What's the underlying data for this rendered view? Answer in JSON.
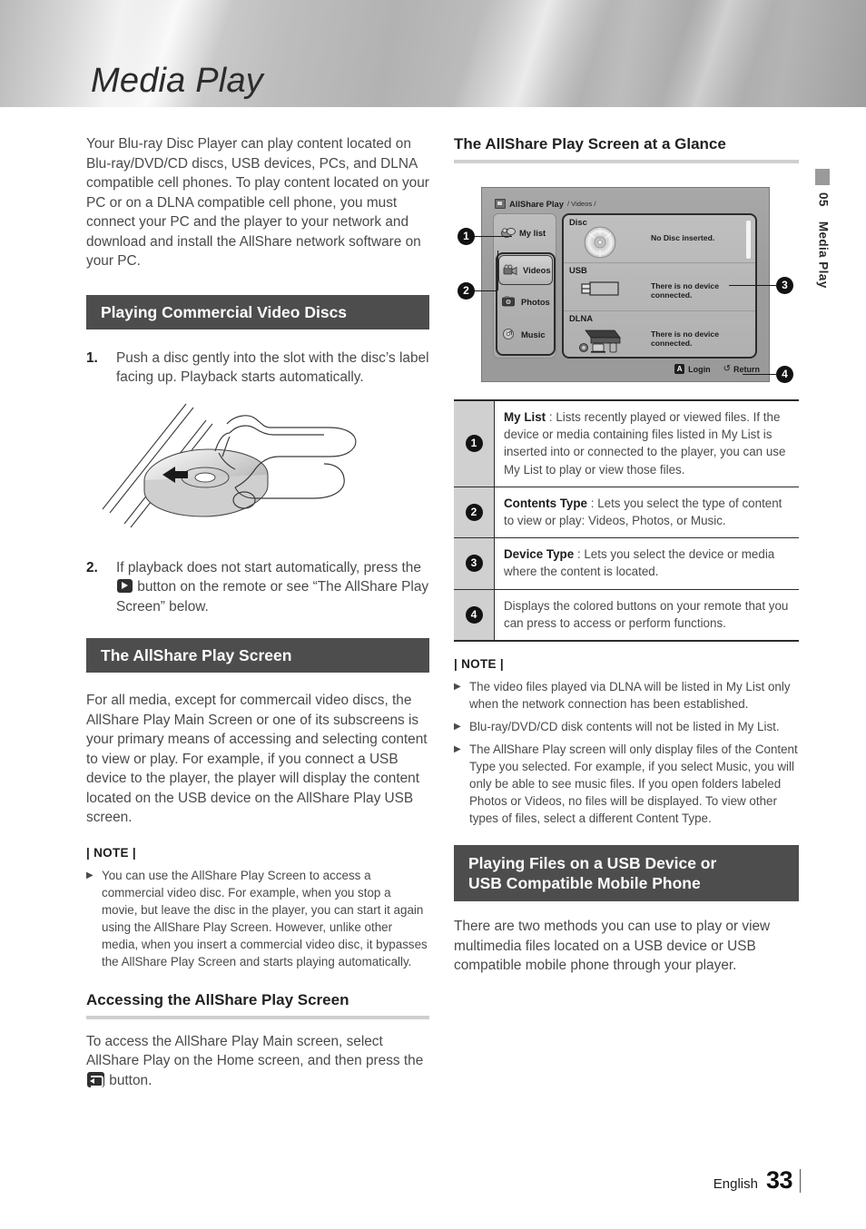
{
  "header": {
    "title": "Media Play"
  },
  "side_tab": {
    "number": "05",
    "label": "Media Play"
  },
  "left": {
    "intro": "Your Blu-ray Disc Player can play content located on Blu-ray/DVD/CD discs, USB devices, PCs, and DLNA compatible cell phones. To play content located on your PC or on a DLNA compatible cell phone, you must connect your PC and the player to your network and download and install the AllShare network software on your PC.",
    "banner1": "Playing Commercial Video Discs",
    "step1_num": "1.",
    "step1_text": "Push a disc gently into the slot with the disc’s label facing up. Playback starts automatically.",
    "step2_num": "2.",
    "step2_a": "If playback does not start automatically, press the",
    "step2_b": "button on the remote or see “The AllShare Play Screen” below.",
    "banner2": "The AllShare Play Screen",
    "para2": "For all media, except for commercail video discs, the AllShare Play Main Screen or one of its subscreens is your primary means of accessing and selecting content to view or play. For example, if you connect a USB device to the player, the player will display the content located on the USB device on the AllShare Play USB screen.",
    "note_label": "| NOTE |",
    "note_items": [
      "You can use the AllShare Play Screen to access a commercial video disc. For example, when you stop a movie, but leave the disc in the player, you can start it again using the AllShare Play Screen. However, unlike other media, when you insert a commercial video disc, it bypasses the AllShare Play Screen and starts playing automatically."
    ],
    "subhead": "Accessing the AllShare Play Screen",
    "para3_a": "To access the AllShare Play Main screen, select AllShare Play on the Home screen, and then press the",
    "para3_b": "button."
  },
  "right": {
    "subhead": "The AllShare Play Screen at a Glance",
    "screen": {
      "breadcrumb_app": "AllShare Play",
      "breadcrumb_path": "/ Videos /",
      "my_list": "My list",
      "content_types": [
        "Videos",
        "Photos",
        "Music"
      ],
      "selected_type": "Videos",
      "devices": [
        {
          "title": "Disc",
          "message": "No Disc inserted."
        },
        {
          "title": "USB",
          "message": "There is no device connected."
        },
        {
          "title": "DLNA",
          "message": "There is no device connected."
        }
      ],
      "footer_keys": [
        {
          "key": "A",
          "label": "Login"
        },
        {
          "key": "↺",
          "label": "Return"
        }
      ]
    },
    "callouts": [
      "1",
      "2",
      "3",
      "4"
    ],
    "legend": [
      {
        "num": "1",
        "term": "My List",
        "sep": " : ",
        "text": "Lists recently played or viewed files. If the device or media containing files listed in My List is inserted into or connected to the player, you can use My List to play or view those files."
      },
      {
        "num": "2",
        "term": "Contents Type",
        "sep": " : ",
        "text": "Lets you select the type of content to view or play: Videos, Photos, or Music."
      },
      {
        "num": "3",
        "term": "Device Type",
        "sep": " : ",
        "text": "Lets you select the device or media where the content is located."
      },
      {
        "num": "4",
        "term": "",
        "sep": "",
        "text": "Displays the colored buttons on your remote that you can press to access or perform functions."
      }
    ],
    "note_label": "| NOTE |",
    "note_items": [
      "The video files played via DLNA will be listed in My List only when the network connection has been established.",
      "Blu-ray/DVD/CD disk contents will not be listed in My List.",
      "The AllShare Play screen will only display files of the Content Type you selected. For example, if you select Music, you will only be able to see music files. If you open folders labeled Photos or Videos, no files will be displayed. To view other types of files, select a different Content Type."
    ],
    "banner_line1": "Playing Files on a USB Device or",
    "banner_line2": "USB Compatible Mobile Phone",
    "para": "There are two methods you can use to play or view multimedia files located on a USB device or USB compatible mobile phone through your player."
  },
  "footer": {
    "language": "English",
    "page": "33"
  }
}
